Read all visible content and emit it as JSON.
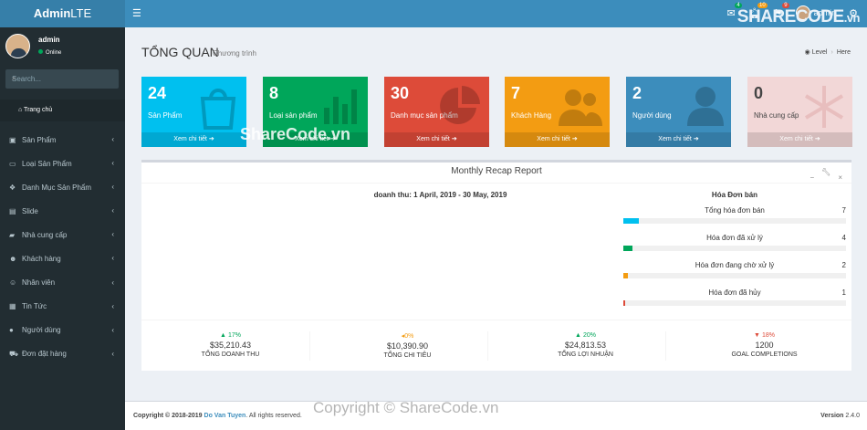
{
  "header": {
    "logo_bold": "Admin",
    "logo_rest": "LTE",
    "toggle_icon": "bars-icon",
    "notifications": [
      {
        "icon": "envelope-icon",
        "badge": "4",
        "color": "#00a65a"
      },
      {
        "icon": "bell-icon",
        "badge": "10",
        "color": "#f39c12"
      },
      {
        "icon": "flag-icon",
        "badge": "9",
        "color": "#dd4b39"
      }
    ],
    "user_name": "admin",
    "watermark_main": "SHARECODE",
    "watermark_suffix": ".vn"
  },
  "sidebar": {
    "user_name": "admin",
    "user_status": "Online",
    "search_placeholder": "Search...",
    "home_label": "Trang chủ",
    "items": [
      {
        "label": "Sản Phẩm",
        "icon": "shopping-bag-icon"
      },
      {
        "label": "Loại Sản Phẩm",
        "icon": "folder-icon"
      },
      {
        "label": "Danh Mục Sản Phẩm",
        "icon": "cubes-icon"
      },
      {
        "label": "Slide",
        "icon": "image-icon"
      },
      {
        "label": "Nhà cung cấp",
        "icon": "truck-icon"
      },
      {
        "label": "Khách hàng",
        "icon": "users-icon"
      },
      {
        "label": "Nhân viên",
        "icon": "user-icon"
      },
      {
        "label": "Tin Tức",
        "icon": "newspaper-icon"
      },
      {
        "label": "Người dùng",
        "icon": "user-solid-icon"
      },
      {
        "label": "Đơn đặt hàng",
        "icon": "cart-icon"
      }
    ]
  },
  "content": {
    "title": "TỔNG QUAN",
    "subtitle": "Chương trình",
    "breadcrumb": [
      "Level",
      "Here"
    ]
  },
  "stats": [
    {
      "value": "24",
      "label": "Sản Phẩm",
      "link": "Xem chi tiết",
      "color": "#00c0ef",
      "icon": "shopping-bag-icon"
    },
    {
      "value": "8",
      "label": "Loại sản phẩm",
      "link": "Xem chi tiết",
      "color": "#00a65a",
      "icon": "bar-chart-icon"
    },
    {
      "value": "30",
      "label": "Danh mục sản phẩm",
      "link": "Xem chi tiết",
      "color": "#dd4b39",
      "icon": "pie-chart-icon"
    },
    {
      "value": "7",
      "label": "Khách Hàng",
      "link": "Xem chi tiết",
      "color": "#f39c12",
      "icon": "users-icon"
    },
    {
      "value": "2",
      "label": "Người dùng",
      "link": "Xem chi tiết",
      "color": "#3c8dbc",
      "icon": "user-icon"
    },
    {
      "value": "0",
      "label": "Nhà cung cấp",
      "link": "Xem chi tiết",
      "color": "#f2d7d7",
      "icon": "asterisk-icon"
    }
  ],
  "report": {
    "title": "Monthly Recap Report",
    "chart_title": "doanh thu: 1 April, 2019 - 30 May, 2019",
    "goal_title": "Hóa Đơn bán",
    "progress": [
      {
        "label": "Tổng hóa đơn bán",
        "count": "7",
        "fraction": 0.07,
        "color": "#00c0ef"
      },
      {
        "label": "Hóa đơn đã xử lý",
        "count": "4",
        "fraction": 0.04,
        "color": "#00a65a"
      },
      {
        "label": "Hóa đơn đang chờ xử lý",
        "count": "2",
        "fraction": 0.02,
        "color": "#f39c12"
      },
      {
        "label": "Hóa đơn đã hủy",
        "count": "1",
        "fraction": 0.01,
        "color": "#dd4b39"
      }
    ],
    "descriptions": [
      {
        "arrow": "▲",
        "pct": "17%",
        "amount": "$35,210.43",
        "text": "TỔNG DOANH THU",
        "color": "#00a65a"
      },
      {
        "arrow": "◂",
        "pct": "0%",
        "amount": "$10,390.90",
        "text": "TỔNG CHI TIÊU",
        "color": "#f39c12"
      },
      {
        "arrow": "▲",
        "pct": "20%",
        "amount": "$24,813.53",
        "text": "TỔNG LỢI NHUẬN",
        "color": "#00a65a"
      },
      {
        "arrow": "▼",
        "pct": "18%",
        "amount": "1200",
        "text": "GOAL COMPLETIONS",
        "color": "#dd4b39"
      }
    ]
  },
  "footer": {
    "copyright": "Copyright © 2018-2019",
    "author": "Do Van Tuyen",
    "rights": ". All rights reserved.",
    "version_label": "Version",
    "version": "2.4.0"
  },
  "watermarks": {
    "middle": "ShareCode.vn",
    "bottom": "Copyright © ShareCode.vn"
  }
}
